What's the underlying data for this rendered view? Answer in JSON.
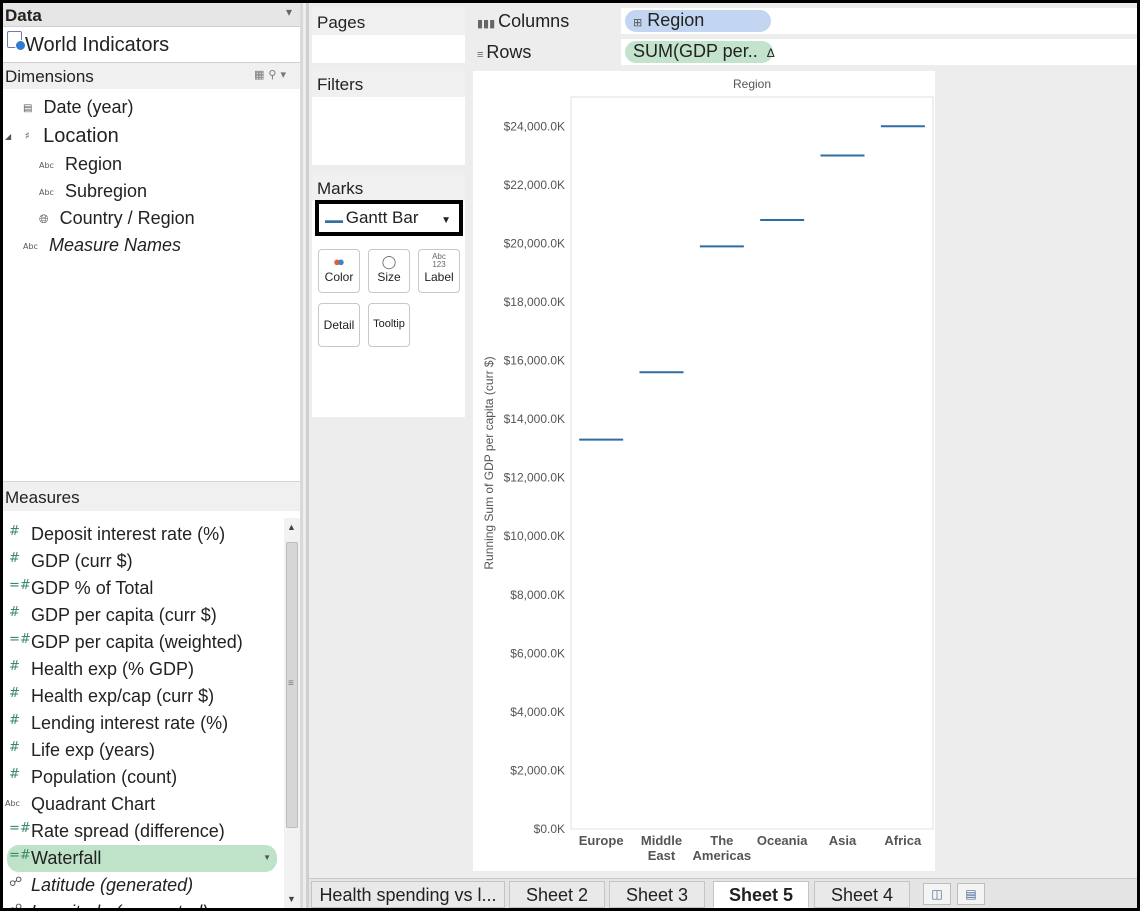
{
  "data_pane": {
    "title": "Data",
    "pin_icon": "pin-icon",
    "datasource": "World Indicators",
    "dimensions_label": "Dimensions",
    "dimensions": [
      {
        "label": "Date (year)",
        "icon": "calendar-icon",
        "italic": false
      },
      {
        "label": "Location",
        "icon": "hierarchy-icon",
        "italic": false
      },
      {
        "label": "Region",
        "icon": "abc-icon",
        "italic": false
      },
      {
        "label": "Subregion",
        "icon": "abc-icon",
        "italic": false
      },
      {
        "label": "Country / Region",
        "icon": "globe-icon",
        "italic": false
      },
      {
        "label": "Measure Names",
        "icon": "abc-icon",
        "italic": true
      }
    ],
    "measures_label": "Measures",
    "measures": [
      {
        "label": "Deposit interest rate (%)"
      },
      {
        "label": "GDP (curr $)"
      },
      {
        "label": "GDP % of Total"
      },
      {
        "label": "GDP per capita (curr $)"
      },
      {
        "label": "GDP per capita (weighted)"
      },
      {
        "label": "Health exp (% GDP)"
      },
      {
        "label": "Health exp/cap (curr $)"
      },
      {
        "label": "Lending interest rate (%)"
      },
      {
        "label": "Life exp (years)"
      },
      {
        "label": "Population (count)"
      },
      {
        "label": "Quadrant Chart"
      },
      {
        "label": "Rate spread (difference)"
      },
      {
        "label": "Waterfall"
      },
      {
        "label": "Latitude (generated)"
      },
      {
        "label": "Longitude (generated)"
      }
    ]
  },
  "cards": {
    "pages": "Pages",
    "filters": "Filters",
    "marks": "Marks",
    "mark_type": "Gantt Bar",
    "buttons": {
      "color": "Color",
      "size": "Size",
      "label": "Label",
      "detail": "Detail",
      "tooltip": "Tooltip",
      "label_icon_top": "Abc",
      "label_icon_bottom": "123"
    }
  },
  "shelves": {
    "columns_label": "Columns",
    "rows_label": "Rows",
    "columns_pill": "Region",
    "rows_pill": "SUM(GDP per..",
    "rows_pill_icon": "delta-icon"
  },
  "chart_data": {
    "type": "gantt",
    "title": "Region",
    "ylabel": "Running Sum of GDP per capita (curr $)",
    "categories": [
      "Europe",
      "Middle East",
      "The Americas",
      "Oceania",
      "Asia",
      "Africa"
    ],
    "category_lines": [
      [
        "Europe"
      ],
      [
        "Middle",
        "East"
      ],
      [
        "The",
        "Americas"
      ],
      [
        "Oceania"
      ],
      [
        "Asia"
      ],
      [
        "Africa"
      ]
    ],
    "values": [
      13300,
      15600,
      19900,
      20800,
      23000,
      24000
    ],
    "ylim": [
      0,
      25000
    ],
    "yticks": [
      0,
      2000,
      4000,
      6000,
      8000,
      10000,
      12000,
      14000,
      16000,
      18000,
      20000,
      22000,
      24000
    ],
    "ytick_labels": [
      "$0.0K",
      "$2,000.0K",
      "$4,000.0K",
      "$6,000.0K",
      "$8,000.0K",
      "$10,000.0K",
      "$12,000.0K",
      "$14,000.0K",
      "$16,000.0K",
      "$18,000.0K",
      "$20,000.0K",
      "$22,000.0K",
      "$24,000.0K"
    ],
    "mark_color": "#2e6da4",
    "grid": false
  },
  "tabs": [
    {
      "label": "Health spending vs l...",
      "active": false
    },
    {
      "label": "Sheet 2",
      "active": false
    },
    {
      "label": "Sheet 3",
      "active": false
    },
    {
      "label": "Sheet 5",
      "active": true
    },
    {
      "label": "Sheet 4",
      "active": false
    }
  ],
  "tab_icons": [
    "new-worksheet-icon",
    "new-dashboard-icon"
  ]
}
